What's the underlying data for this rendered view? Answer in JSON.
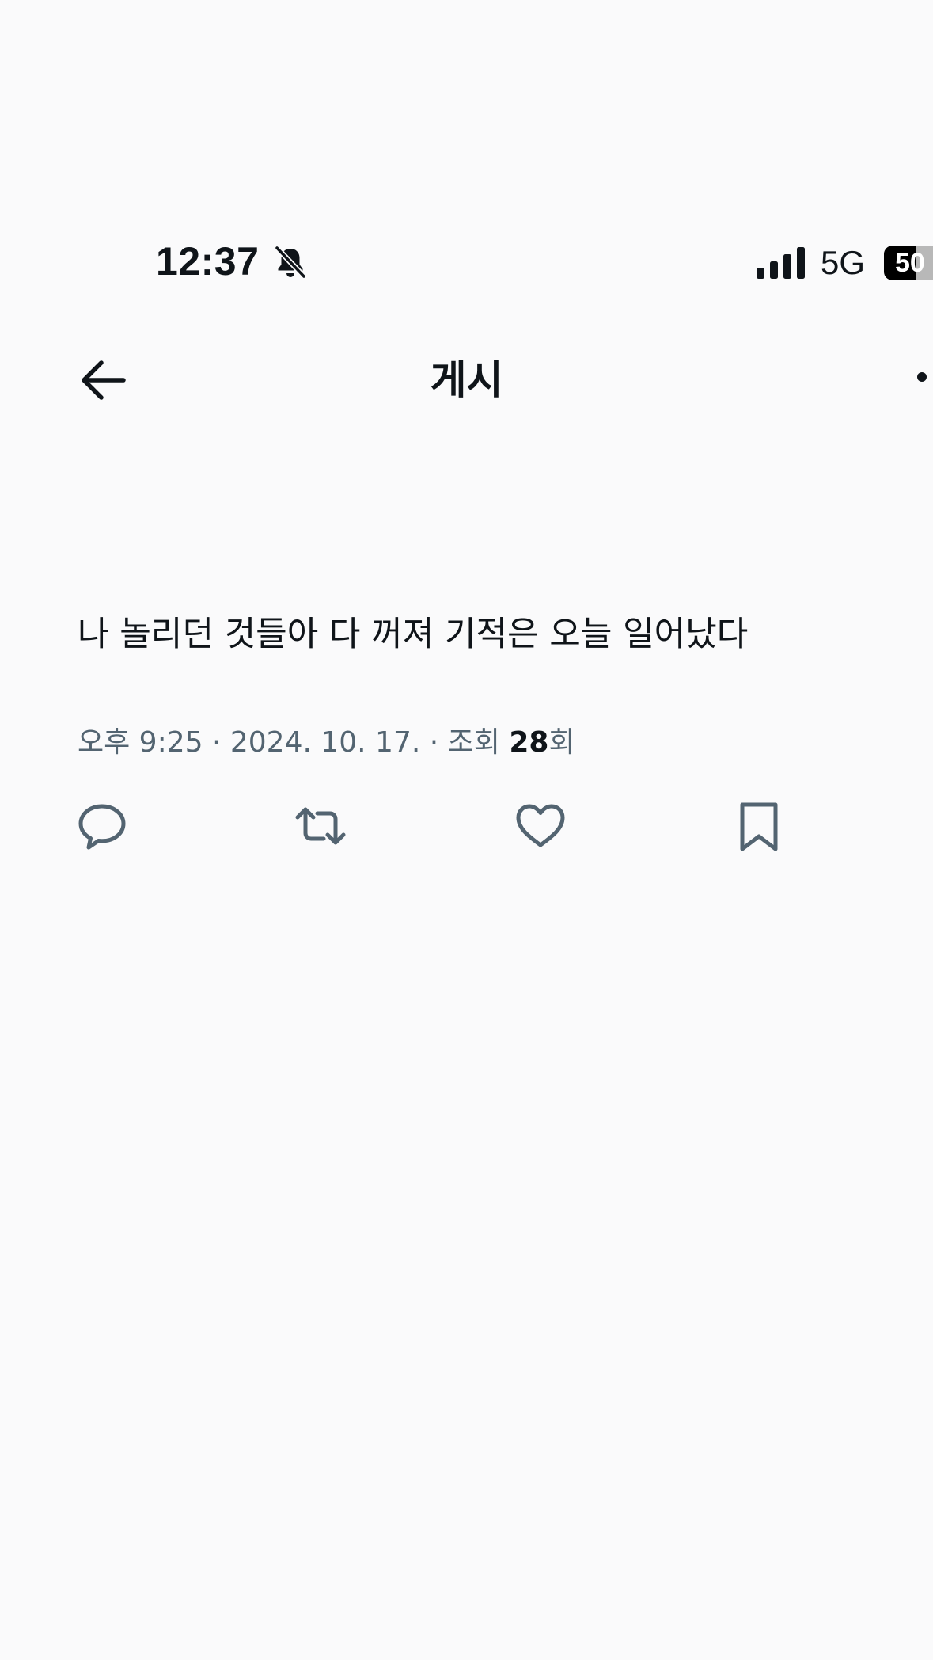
{
  "status_bar": {
    "time": "12:37",
    "network": "5G",
    "battery_level": "50",
    "battery_fraction": 0.5,
    "bell_icon": "bell-slash-icon",
    "signal_icon": "cellular-signal-icon"
  },
  "header": {
    "title": "게시",
    "back_icon": "arrow-left-icon",
    "more_icon": "more-dots-icon"
  },
  "post": {
    "text": "나 놀리던 것들아 다 꺼져 기적은 오늘 일어났다",
    "meta_prefix": "오후 9:25 · 2024. 10. 17. · 조회 ",
    "views": "28",
    "views_suffix": "회"
  },
  "actions": {
    "reply_icon": "comment-icon",
    "repost_icon": "repost-icon",
    "like_icon": "heart-icon",
    "bookmark_icon": "bookmark-icon"
  },
  "colors": {
    "text_primary": "#0f1419",
    "text_secondary": "#536471",
    "background": "#fafafb"
  }
}
